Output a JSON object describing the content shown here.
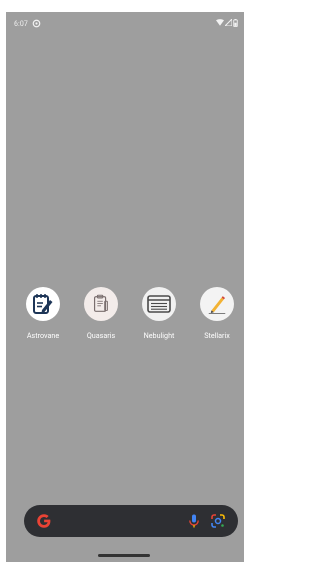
{
  "status_bar": {
    "time": "6:07",
    "left_icon": "data-saver-icon",
    "right_icons": [
      "wifi-icon",
      "cell-signal-icon",
      "battery-icon"
    ]
  },
  "home": {
    "apps": [
      {
        "label": "Astrovane",
        "icon": "notepad-pen-icon",
        "icon_bg": "#ffffff"
      },
      {
        "label": "Quasaris",
        "icon": "clipboard-icon",
        "icon_bg": "#f3ecea"
      },
      {
        "label": "Nebulight",
        "icon": "stacked-documents-icon",
        "icon_bg": "#f1f1f1"
      },
      {
        "label": "Stellarix",
        "icon": "pencil-icon",
        "icon_bg": "#f3f3f3"
      }
    ]
  },
  "search_bar": {
    "logo": "google-g-icon",
    "mic": "microphone-icon",
    "lens": "google-lens-icon"
  },
  "colors": {
    "wallpaper": "#9e9e9e",
    "search_bg": "#2e2f33"
  }
}
